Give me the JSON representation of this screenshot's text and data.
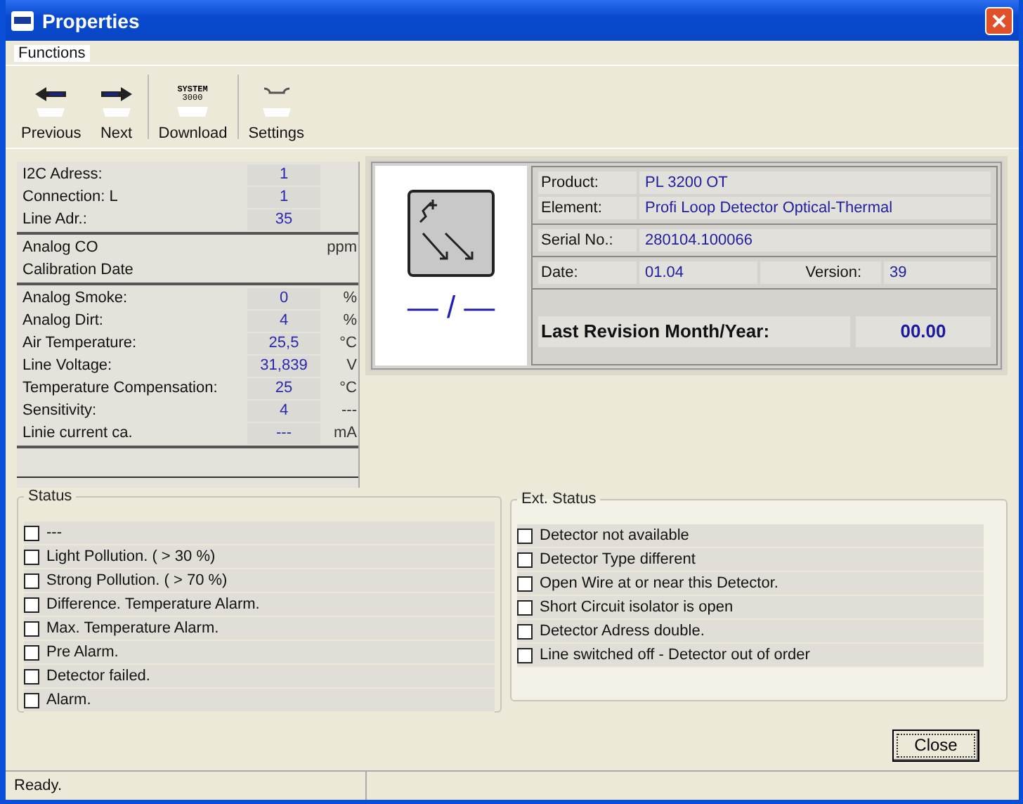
{
  "window": {
    "title": "Properties"
  },
  "menu": [
    {
      "label": "Functions"
    }
  ],
  "toolbar": [
    {
      "label": "Previous",
      "kind": "back"
    },
    {
      "label": "Next",
      "kind": "forward"
    },
    {
      "label": "Download",
      "kind": "download"
    },
    {
      "label": "Settings",
      "kind": "settings"
    }
  ],
  "system_icon_text": [
    "SYSTEM",
    "3000"
  ],
  "values": {
    "groups": [
      [
        {
          "label": "I2C Adress:",
          "value": "1"
        },
        {
          "label": "Connection: L",
          "value": "1"
        },
        {
          "label": "Line Adr.:",
          "value": "35"
        }
      ],
      [
        {
          "label": "Analog CO",
          "unit": "ppm"
        },
        {
          "label": "Calibration Date"
        }
      ],
      [
        {
          "label": "Analog Smoke:",
          "value": "0",
          "unit": "%"
        },
        {
          "label": "Analog Dirt:",
          "value": "4",
          "unit": "%"
        },
        {
          "label": "Air Temperature:",
          "value": "25,5",
          "unit": "°C"
        },
        {
          "label": "Line Voltage:",
          "value": "31,839",
          "unit": "V"
        },
        {
          "label": "Temperature Compensation:",
          "value": "25",
          "unit": "°C"
        },
        {
          "label": "Sensitivity:",
          "value": "4",
          "unit": "---"
        },
        {
          "label": "Linie current ca.",
          "value": "---",
          "unit": "mA"
        }
      ]
    ]
  },
  "device": {
    "symbol_caption": "— / —",
    "product_label": "Product:",
    "product": "PL 3200 OT",
    "element_label": "Element:",
    "element": "Profi Loop Detector Optical-Thermal",
    "serial_label": "Serial No.:",
    "serial": "280104.100066",
    "date_label": "Date:",
    "date": "01.04",
    "version_label": "Version:",
    "version": "39",
    "revision_label": "Last Revision Month/Year:",
    "revision": "00.00"
  },
  "status": {
    "title": "Status",
    "items": [
      {
        "label": "---",
        "checked": false
      },
      {
        "label": "Light Pollution. ( > 30 %)",
        "checked": false
      },
      {
        "label": "Strong Pollution. ( > 70 %)",
        "checked": false
      },
      {
        "label": "Difference. Temperature Alarm.",
        "checked": false
      },
      {
        "label": "Max. Temperature Alarm.",
        "checked": false
      },
      {
        "label": "Pre Alarm.",
        "checked": false
      },
      {
        "label": "Detector failed.",
        "checked": false
      },
      {
        "label": "Alarm.",
        "checked": false
      }
    ]
  },
  "ext_status": {
    "title": "Ext. Status",
    "items": [
      {
        "label": "Detector not available",
        "checked": false
      },
      {
        "label": "Detector Type different",
        "checked": false
      },
      {
        "label": "Open Wire at or near this Detector.",
        "checked": false
      },
      {
        "label": "Short Circuit isolator is open",
        "checked": false
      },
      {
        "label": "Detector Adress double.",
        "checked": false
      },
      {
        "label": "Line switched off - Detector out of order",
        "checked": false
      }
    ]
  },
  "buttons": [
    {
      "label": "Close"
    }
  ],
  "status_bar": "Ready."
}
